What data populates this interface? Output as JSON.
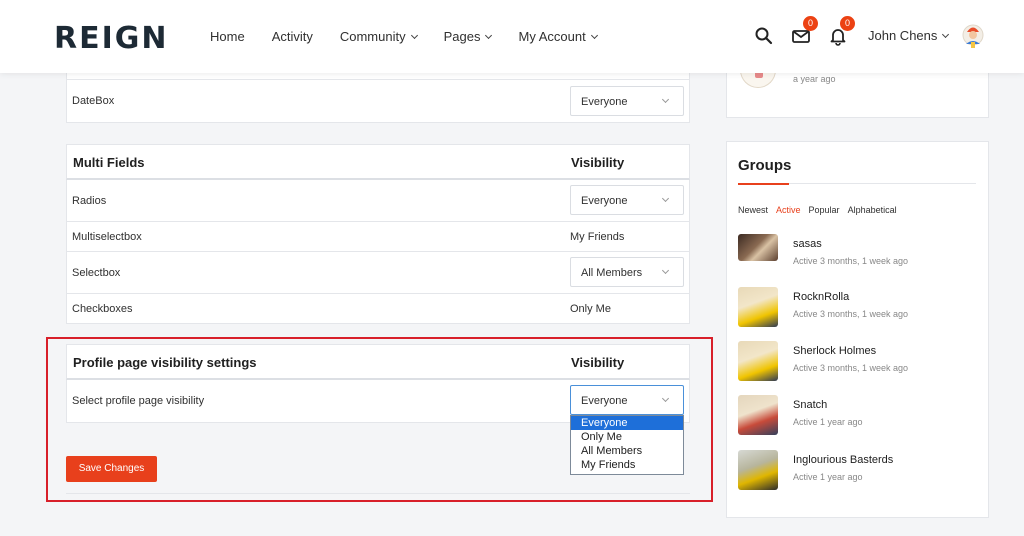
{
  "header": {
    "logo": "REIGN",
    "nav": [
      {
        "label": "Home",
        "dropdown": false
      },
      {
        "label": "Activity",
        "dropdown": false
      },
      {
        "label": "Community",
        "dropdown": true
      },
      {
        "label": "Pages",
        "dropdown": true
      },
      {
        "label": "My Account",
        "dropdown": true
      }
    ],
    "messages_count": "0",
    "notifications_count": "0",
    "user_name": "John Chens"
  },
  "base_fields": {
    "datebox": {
      "label": "DateBox",
      "value": "Everyone"
    }
  },
  "multi_fields": {
    "heading": "Multi Fields",
    "visibility_heading": "Visibility",
    "rows": [
      {
        "label": "Radios",
        "value": "Everyone",
        "select": true
      },
      {
        "label": "Multiselectbox",
        "value": "My Friends",
        "select": false
      },
      {
        "label": "Selectbox",
        "value": "All Members",
        "select": true
      },
      {
        "label": "Checkboxes",
        "value": "Only Me",
        "select": false
      }
    ]
  },
  "profile_visibility": {
    "heading": "Profile page visibility settings",
    "visibility_heading": "Visibility",
    "row_label": "Select profile page visibility",
    "value": "Everyone",
    "options": [
      "Everyone",
      "Only Me",
      "All Members",
      "My Friends"
    ],
    "save_label": "Save Changes"
  },
  "sidebar": {
    "prev_activity_time": "a year ago",
    "groups_title": "Groups",
    "filters": [
      "Newest",
      "Active",
      "Popular",
      "Alphabetical"
    ],
    "active_filter": "Active",
    "groups": [
      {
        "name": "sasas",
        "time": "Active 3 months, 1 week ago"
      },
      {
        "name": "RocknRolla",
        "time": "Active 3 months, 1 week ago"
      },
      {
        "name": "Sherlock Holmes",
        "time": "Active 3 months, 1 week ago"
      },
      {
        "name": "Snatch",
        "time": "Active 1 year ago"
      },
      {
        "name": "Inglourious Basterds",
        "time": "Active 1 year ago"
      }
    ]
  },
  "colors": {
    "accent": "#e8401c",
    "highlight_border": "#d8202a",
    "dropdown_selected": "#1e6fd9"
  }
}
